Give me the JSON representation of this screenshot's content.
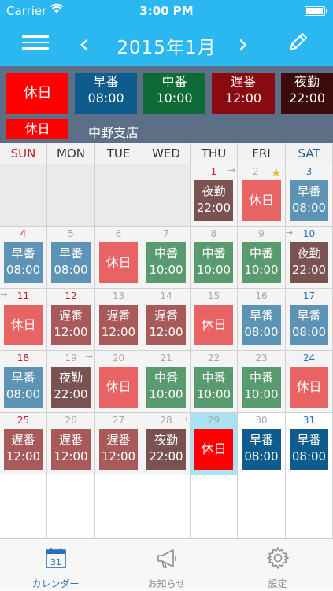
{
  "status": {
    "carrier": "Carrier",
    "time": "3:00 PM",
    "battery_percent": 100
  },
  "nav": {
    "title": "2015年1月",
    "prev": "‹",
    "next": "›"
  },
  "shift_types": [
    {
      "name": "休日",
      "time": "",
      "color": "#ff0000"
    },
    {
      "name": "早番",
      "time": "08:00",
      "color": "#0e5c8c"
    },
    {
      "name": "中番",
      "time": "10:00",
      "color": "#0f6b36"
    },
    {
      "name": "遅番",
      "time": "12:00",
      "color": "#8a0a12"
    },
    {
      "name": "夜勤",
      "time": "22:00",
      "color": "#3b0a0a"
    }
  ],
  "branch": {
    "chip": "休日",
    "name": "中野支店"
  },
  "weekdays": [
    "SUN",
    "MON",
    "TUE",
    "WED",
    "THU",
    "FRI",
    "SAT"
  ],
  "calendar": [
    [
      {
        "day": "",
        "label": "",
        "time": ""
      },
      {
        "day": "",
        "label": "",
        "time": ""
      },
      {
        "day": "",
        "label": "",
        "time": ""
      },
      {
        "day": "",
        "label": "",
        "time": ""
      },
      {
        "day": "1",
        "label": "夜勤",
        "time": "22:00",
        "color": "#7b5252",
        "arrowOut": true
      },
      {
        "day": "2",
        "label": "休日",
        "time": "",
        "color": "#e86464",
        "star": true
      },
      {
        "day": "3",
        "label": "早番",
        "time": "08:00",
        "color": "#5d93b5"
      }
    ],
    [
      {
        "day": "4",
        "label": "早番",
        "time": "08:00",
        "color": "#5d93b5"
      },
      {
        "day": "5",
        "label": "早番",
        "time": "08:00",
        "color": "#5d93b5"
      },
      {
        "day": "6",
        "label": "休日",
        "time": "",
        "color": "#e86464"
      },
      {
        "day": "7",
        "label": "中番",
        "time": "10:00",
        "color": "#5a9a6f"
      },
      {
        "day": "8",
        "label": "中番",
        "time": "10:00",
        "color": "#5a9a6f"
      },
      {
        "day": "9",
        "label": "中番",
        "time": "10:00",
        "color": "#5a9a6f"
      },
      {
        "day": "10",
        "label": "夜勤",
        "time": "22:00",
        "color": "#7b5252",
        "arrowIn": true
      }
    ],
    [
      {
        "day": "11",
        "label": "休日",
        "time": "",
        "color": "#e86464",
        "arrowIn": true
      },
      {
        "day": "12",
        "label": "遅番",
        "time": "12:00",
        "color": "#a85a5a"
      },
      {
        "day": "13",
        "label": "遅番",
        "time": "12:00",
        "color": "#a85a5a"
      },
      {
        "day": "14",
        "label": "遅番",
        "time": "12:00",
        "color": "#a85a5a"
      },
      {
        "day": "15",
        "label": "休日",
        "time": "",
        "color": "#e86464"
      },
      {
        "day": "16",
        "label": "早番",
        "time": "08:00",
        "color": "#5d93b5"
      },
      {
        "day": "17",
        "label": "早番",
        "time": "08:00",
        "color": "#5d93b5"
      }
    ],
    [
      {
        "day": "18",
        "label": "早番",
        "time": "08:00",
        "color": "#5d93b5"
      },
      {
        "day": "19",
        "label": "夜勤",
        "time": "22:00",
        "color": "#7b5252",
        "arrowOut": true
      },
      {
        "day": "20",
        "label": "休日",
        "time": "",
        "color": "#e86464"
      },
      {
        "day": "21",
        "label": "中番",
        "time": "10:00",
        "color": "#5a9a6f"
      },
      {
        "day": "22",
        "label": "中番",
        "time": "10:00",
        "color": "#5a9a6f"
      },
      {
        "day": "23",
        "label": "中番",
        "time": "10:00",
        "color": "#5a9a6f"
      },
      {
        "day": "24",
        "label": "休日",
        "time": "",
        "color": "#e86464"
      }
    ],
    [
      {
        "day": "25",
        "label": "遅番",
        "time": "12:00",
        "color": "#a85a5a"
      },
      {
        "day": "26",
        "label": "遅番",
        "time": "12:00",
        "color": "#a85a5a"
      },
      {
        "day": "27",
        "label": "遅番",
        "time": "12:00",
        "color": "#a85a5a"
      },
      {
        "day": "28",
        "label": "夜勤",
        "time": "22:00",
        "color": "#7b5252",
        "arrowOut": true
      },
      {
        "day": "29",
        "label": "休日",
        "time": "",
        "color": "#ff0000",
        "today": true
      },
      {
        "day": "30",
        "label": "早番",
        "time": "08:00",
        "color": "#0e5c8c",
        "future": true
      },
      {
        "day": "31",
        "label": "早番",
        "time": "08:00",
        "color": "#0e5c8c",
        "future": true
      }
    ]
  ],
  "tabs": [
    {
      "label": "カレンダー",
      "icon": "calendar-icon",
      "icon_text": "31",
      "active": true
    },
    {
      "label": "お知らせ",
      "icon": "megaphone-icon",
      "active": false
    },
    {
      "label": "設定",
      "icon": "gear-icon",
      "active": false
    }
  ]
}
